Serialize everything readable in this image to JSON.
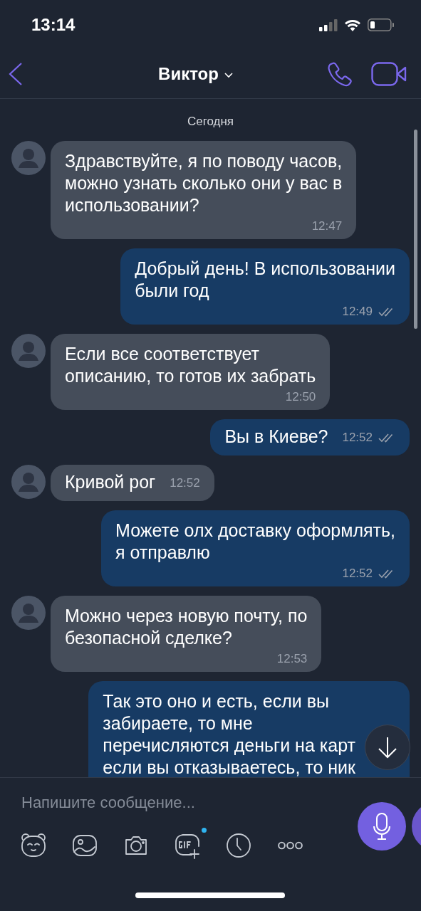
{
  "status_bar": {
    "time": "13:14"
  },
  "header": {
    "title": "Виктор"
  },
  "date_separator": "Сегодня",
  "messages": [
    {
      "kind": "incoming",
      "lines": [
        "Здравствуйте, я по поводу часов,",
        "можно узнать сколько они у вас в",
        "использовании?"
      ],
      "time": "12:47",
      "time_inline": false
    },
    {
      "kind": "outgoing",
      "lines": [
        "Добрый день! В использовании",
        "были год"
      ],
      "time": "12:49",
      "time_inline": false,
      "read": true
    },
    {
      "kind": "incoming",
      "lines": [
        "Если все соответствует",
        "описанию, то готов их забрать"
      ],
      "time": "12:50",
      "time_inline": false
    },
    {
      "kind": "outgoing",
      "lines": [
        "Вы в Киеве?"
      ],
      "time": "12:52",
      "time_inline": true,
      "read": true
    },
    {
      "kind": "incoming",
      "lines": [
        "Кривой рог"
      ],
      "time": "12:52",
      "time_inline": true
    },
    {
      "kind": "outgoing",
      "lines": [
        "Можете олх доставку оформлять,",
        "я отправлю"
      ],
      "time": "12:52",
      "time_inline": false,
      "read": true
    },
    {
      "kind": "incoming",
      "lines": [
        "Можно через новую почту, по",
        "безопасной сделке?"
      ],
      "time": "12:53",
      "time_inline": false
    },
    {
      "kind": "outgoing",
      "lines": [
        "Так это оно и есть, если вы",
        "забираете, то мне",
        "перечисляются деньги на карт",
        "если вы отказываетесь, то ник"
      ]
    }
  ],
  "composer": {
    "placeholder": "Напишите сообщение..."
  },
  "toolbar": [
    {
      "kind": "sticker",
      "dot": false
    },
    {
      "kind": "gallery",
      "dot": false
    },
    {
      "kind": "camera",
      "dot": false
    },
    {
      "kind": "gif",
      "dot": true
    },
    {
      "kind": "timer",
      "dot": false
    },
    {
      "kind": "more",
      "dot": false
    }
  ]
}
